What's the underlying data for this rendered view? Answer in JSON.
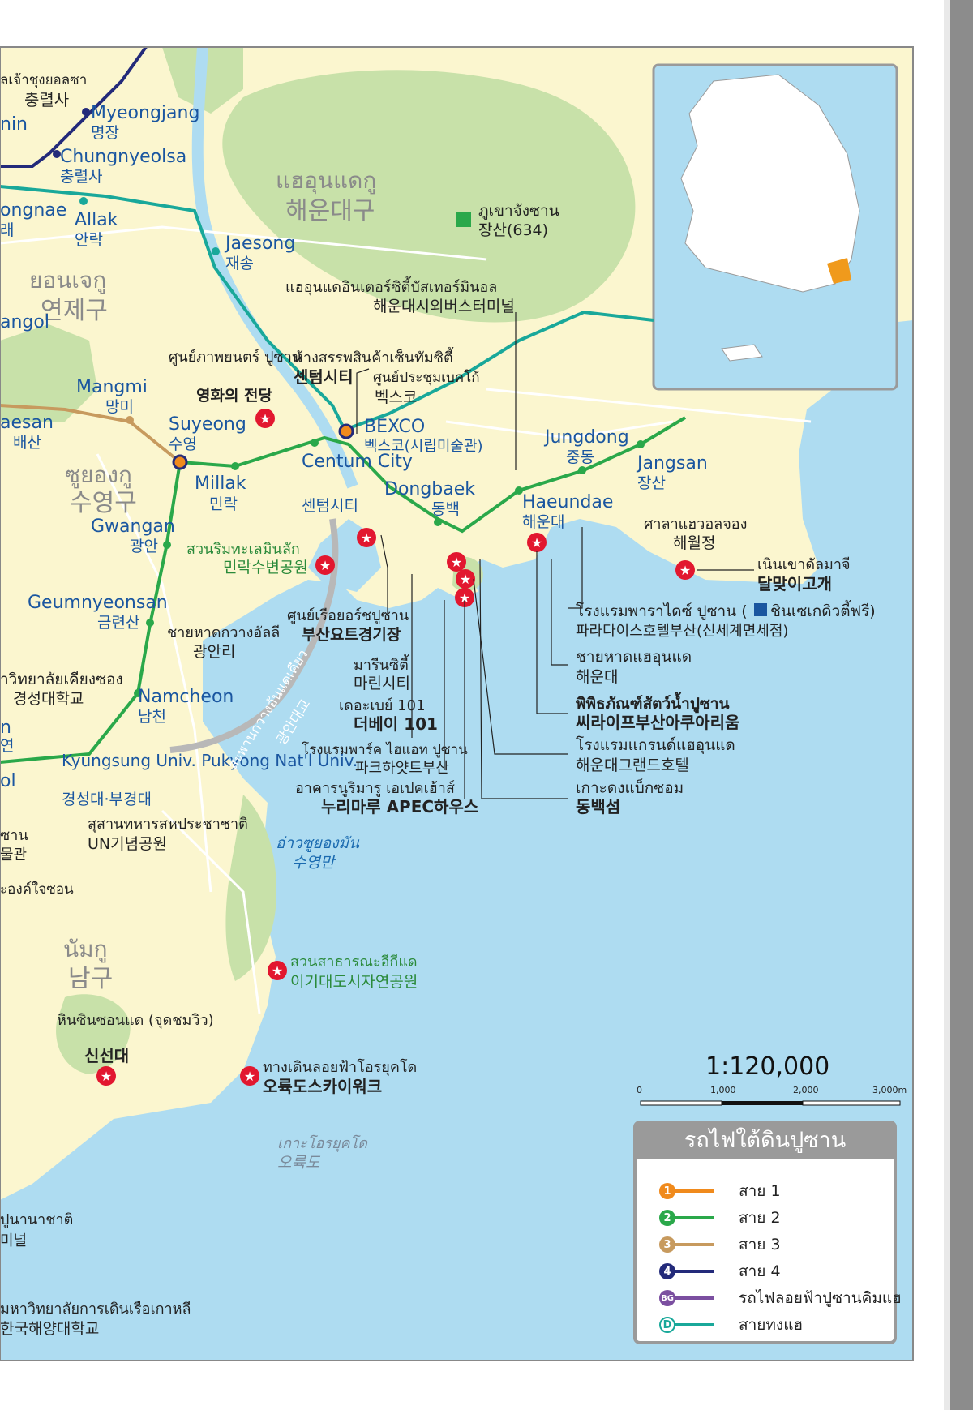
{
  "districts": [
    {
      "id": "haeundae",
      "thai": "แฮอุนแดกู",
      "korean": "해운대구"
    },
    {
      "id": "yeonje",
      "thai": "ยอนเจกู",
      "korean": "연제구"
    },
    {
      "id": "suyeong",
      "thai": "ซูยองกู",
      "korean": "수영구"
    },
    {
      "id": "nam",
      "thai": "นัมกู",
      "korean": "남구"
    }
  ],
  "stations": [
    {
      "id": "myeongjang",
      "en": "Myeongjang",
      "ko": "명장"
    },
    {
      "id": "chungnyeolsa",
      "en": "Chungnyeolsa",
      "ko": "충렬사"
    },
    {
      "id": "allak",
      "en": "Allak",
      "ko": "안락"
    },
    {
      "id": "jaesong",
      "en": "Jaesong",
      "ko": "재송"
    },
    {
      "id": "mangmi",
      "en": "Mangmi",
      "ko": "망미"
    },
    {
      "id": "suyeong",
      "en": "Suyeong",
      "ko": "수영"
    },
    {
      "id": "millak",
      "en": "Millak",
      "ko": "민락"
    },
    {
      "id": "centum",
      "en": "Centum City",
      "ko": "센텀시티"
    },
    {
      "id": "dongbaek",
      "en": "Dongbaek",
      "ko": "동백"
    },
    {
      "id": "haeundae",
      "en": "Haeundae",
      "ko": "해운대"
    },
    {
      "id": "jungdong",
      "en": "Jungdong",
      "ko": "중동"
    },
    {
      "id": "jangsan",
      "en": "Jangsan",
      "ko": "장산"
    },
    {
      "id": "gwangan",
      "en": "Gwangan",
      "ko": "광안"
    },
    {
      "id": "geumnyeonsan",
      "en": "Geumnyeonsan",
      "ko": "금련산"
    },
    {
      "id": "namcheon",
      "en": "Namcheon",
      "ko": "남천"
    },
    {
      "id": "kyungsung",
      "en": "Kyungsung Univ. Pukyong Nat'l Univ.",
      "ko": "경성대·부경대"
    },
    {
      "id": "bexco",
      "en": "BEXCO",
      "ko": "벡스코(시립미술관)"
    }
  ],
  "edge_text": {
    "t1": "ลเจ้าชุงยอลซา",
    "t2": "충렬사",
    "t3": "nin",
    "t4": "ongnae",
    "t5": "래",
    "t6": "angol",
    "t7": "aesan",
    "t8": "배산",
    "t9": "าวิทยาลัยเคียงซอง",
    "t10": "경성대학교",
    "t11": "n",
    "t12": "연",
    "t13": "ol",
    "t14": "ซาน",
    "t15": "물관",
    "t16": "ะองค์ใจซอน",
    "t17": "ปูนานาชาติ",
    "t18": "미널",
    "t19": "มหาวิทยาลัยการเดินเรือเกาหลี",
    "t20": "한국해양대학교"
  },
  "places": [
    {
      "id": "jangsan-mtn",
      "thai": "ภูเขาจังซาน",
      "ko": "장산(634)"
    },
    {
      "id": "bus-terminal",
      "thai": "แฮอุนแดอินเตอร์ซิตี้บัสเทอร์มินอล",
      "ko": "해운대시외버스터미널"
    },
    {
      "id": "cinema",
      "thai": "ศูนย์ภาพยนตร์ ปูซาน",
      "ko": "영화의 전당"
    },
    {
      "id": "centum-dept",
      "thai": "ห้างสรรพสินค้าเซ็นทัมซิตี้",
      "ko": "센텀시티"
    },
    {
      "id": "bexco-conv",
      "thai": "ศูนย์ประชุมเบคโก้",
      "ko": "벡스코"
    },
    {
      "id": "millak-park",
      "thai": "สวนริมทะเลมินลัก",
      "ko": "민락수변공원"
    },
    {
      "id": "gwangalli-beach",
      "thai": "ชายหาดกวางอัลลี",
      "ko": "광안리"
    },
    {
      "id": "yacht",
      "thai": "ศูนย์เรือยอร์ชปูซาน",
      "ko": "부산요트경기장"
    },
    {
      "id": "marine-city",
      "thai": "มารีนซิตี้",
      "ko": "마린시티"
    },
    {
      "id": "the-bay",
      "thai": "เดอะเบย์ 101",
      "ko": "더베이 101"
    },
    {
      "id": "park-hyatt",
      "thai": "โรงแรมพาร์ค ไฮแอท ปูซาน",
      "ko": "파크하얏트부산"
    },
    {
      "id": "nurimaru",
      "thai": "อาคารนูริมารู เอเปคเฮ้าส์",
      "ko": "누리마루 APEC하우스"
    },
    {
      "id": "haewoljeong",
      "thai": "ศาลาแฮวอลจอง",
      "ko": "해월정"
    },
    {
      "id": "dalmaji",
      "thai": "เนินเขาดัลมาจี",
      "ko": "달맞이고개"
    },
    {
      "id": "paradise",
      "thai": "โรงแรมพาราไดซ์ ปูซาน (",
      "thai2": "ชินเซเกดิวตี้ฟรี)",
      "ko": "파라다이스호텔부산(신세계면세점)"
    },
    {
      "id": "haeundae-beach",
      "thai": "ชายหาดแฮอุนแด",
      "ko": "해운대"
    },
    {
      "id": "aquarium",
      "thai": "พิพิธภัณฑ์สัตว์น้ำปูซาน",
      "ko": "씨라이프부산아쿠아리움"
    },
    {
      "id": "grand-hotel",
      "thai": "โรงแรมแกรนด์แฮอุนแด",
      "ko": "해운대그랜드호텔"
    },
    {
      "id": "dongbaekseom",
      "thai": "เกาะดงแบ็กซอม",
      "ko": "동백섬"
    },
    {
      "id": "un-cemetery",
      "thai": "สุสานทหารสหประชาชาติ",
      "ko": "UN기념공원"
    },
    {
      "id": "igidae",
      "thai": "สวนสาธารณะอีกีแด",
      "ko": "이기대도시자연공원"
    },
    {
      "id": "sinseondae",
      "thai": "หินซินซอนแด (จุดชมวิว)",
      "ko": "신선대"
    },
    {
      "id": "oryukdo-sky",
      "thai": "ทางเดินลอยฟ้าโอรยุคโด",
      "ko": "오륙도스카이워크"
    },
    {
      "id": "oryukdo",
      "thai": "เกาะโอรยุคโด",
      "ko": "오륙도"
    },
    {
      "id": "suyeong-bay",
      "thai": "อ่าวซูยองมัน",
      "ko": "수영만"
    },
    {
      "id": "gwangan-bridge",
      "thai": "สะพานกวางอันแดเคียว",
      "ko": "광안대교"
    }
  ],
  "scale": {
    "ratio": "1:120,000",
    "ticks": [
      "0",
      "1,000",
      "2,000",
      "3,000m"
    ]
  },
  "legend": {
    "title": "รถไฟใต้ดินปูซาน",
    "items": [
      {
        "badge": "1",
        "label": "สาย 1",
        "color": "#f08a1c"
      },
      {
        "badge": "2",
        "label": "สาย 2",
        "color": "#2aa84a"
      },
      {
        "badge": "3",
        "label": "สาย 3",
        "color": "#c79a5e"
      },
      {
        "badge": "4",
        "label": "สาย 4",
        "color": "#232a7a"
      },
      {
        "badge": "BG",
        "label": "รถไฟลอยฟ้าปูซานคิมแฮ",
        "color": "#7b4fa0"
      },
      {
        "badge": "D",
        "label": "สายทงแฮ",
        "color": "#19a89a"
      }
    ]
  },
  "colors": {
    "land": "#fbf6cf",
    "green": "#c8e1a9",
    "sea": "#aedcf1",
    "line2": "#2aa84a",
    "line3": "#c79a5e",
    "line4": "#232a7a",
    "donghae": "#19a89a",
    "poi": "#e2172f"
  }
}
